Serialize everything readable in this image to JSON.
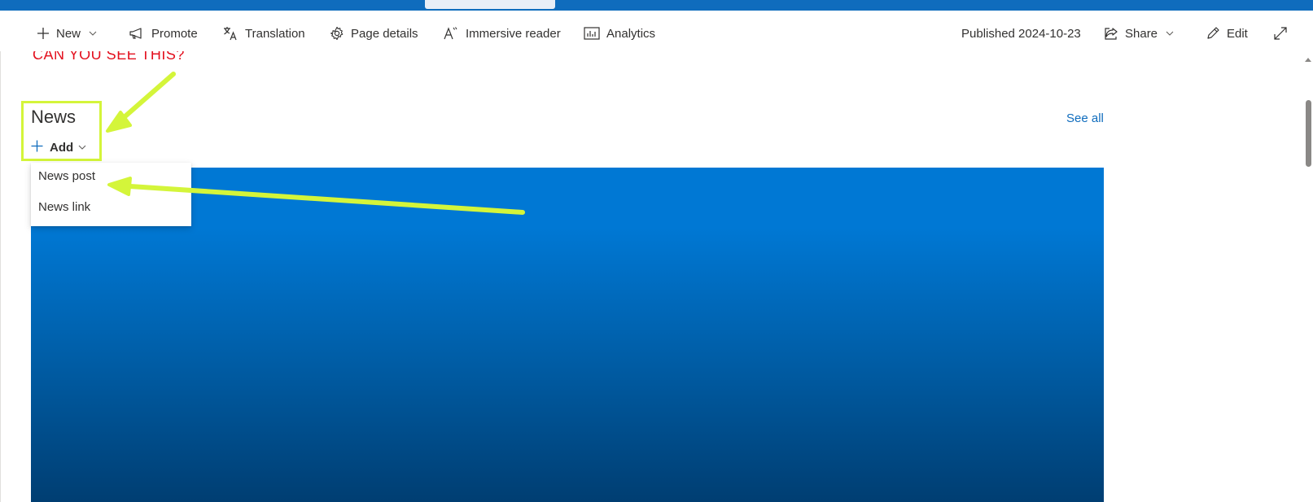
{
  "suite_bar": {
    "accent_color": "#0f6cbd"
  },
  "command_bar": {
    "new_label": "New",
    "promote_label": "Promote",
    "translation_label": "Translation",
    "page_details_label": "Page details",
    "immersive_reader_label": "Immersive reader",
    "analytics_label": "Analytics",
    "published_text": "Published 2024-10-23",
    "share_label": "Share",
    "edit_label": "Edit"
  },
  "page": {
    "red_text": "CAN YOU SEE THIS?",
    "red_color": "#e3101e"
  },
  "news": {
    "title": "News",
    "add_label": "Add",
    "see_all_label": "See all",
    "menu_items": [
      {
        "label": "News post"
      },
      {
        "label": "News link"
      }
    ]
  },
  "annotation": {
    "highlight_color": "#d4f53a"
  },
  "icons": {
    "new": "plus-icon",
    "promote": "megaphone-icon",
    "translation": "translate-icon",
    "page_details": "gear-icon",
    "immersive_reader": "immersive-reader-icon",
    "analytics": "analytics-icon",
    "share": "share-icon",
    "edit": "pencil-icon",
    "expand": "expand-icon"
  }
}
